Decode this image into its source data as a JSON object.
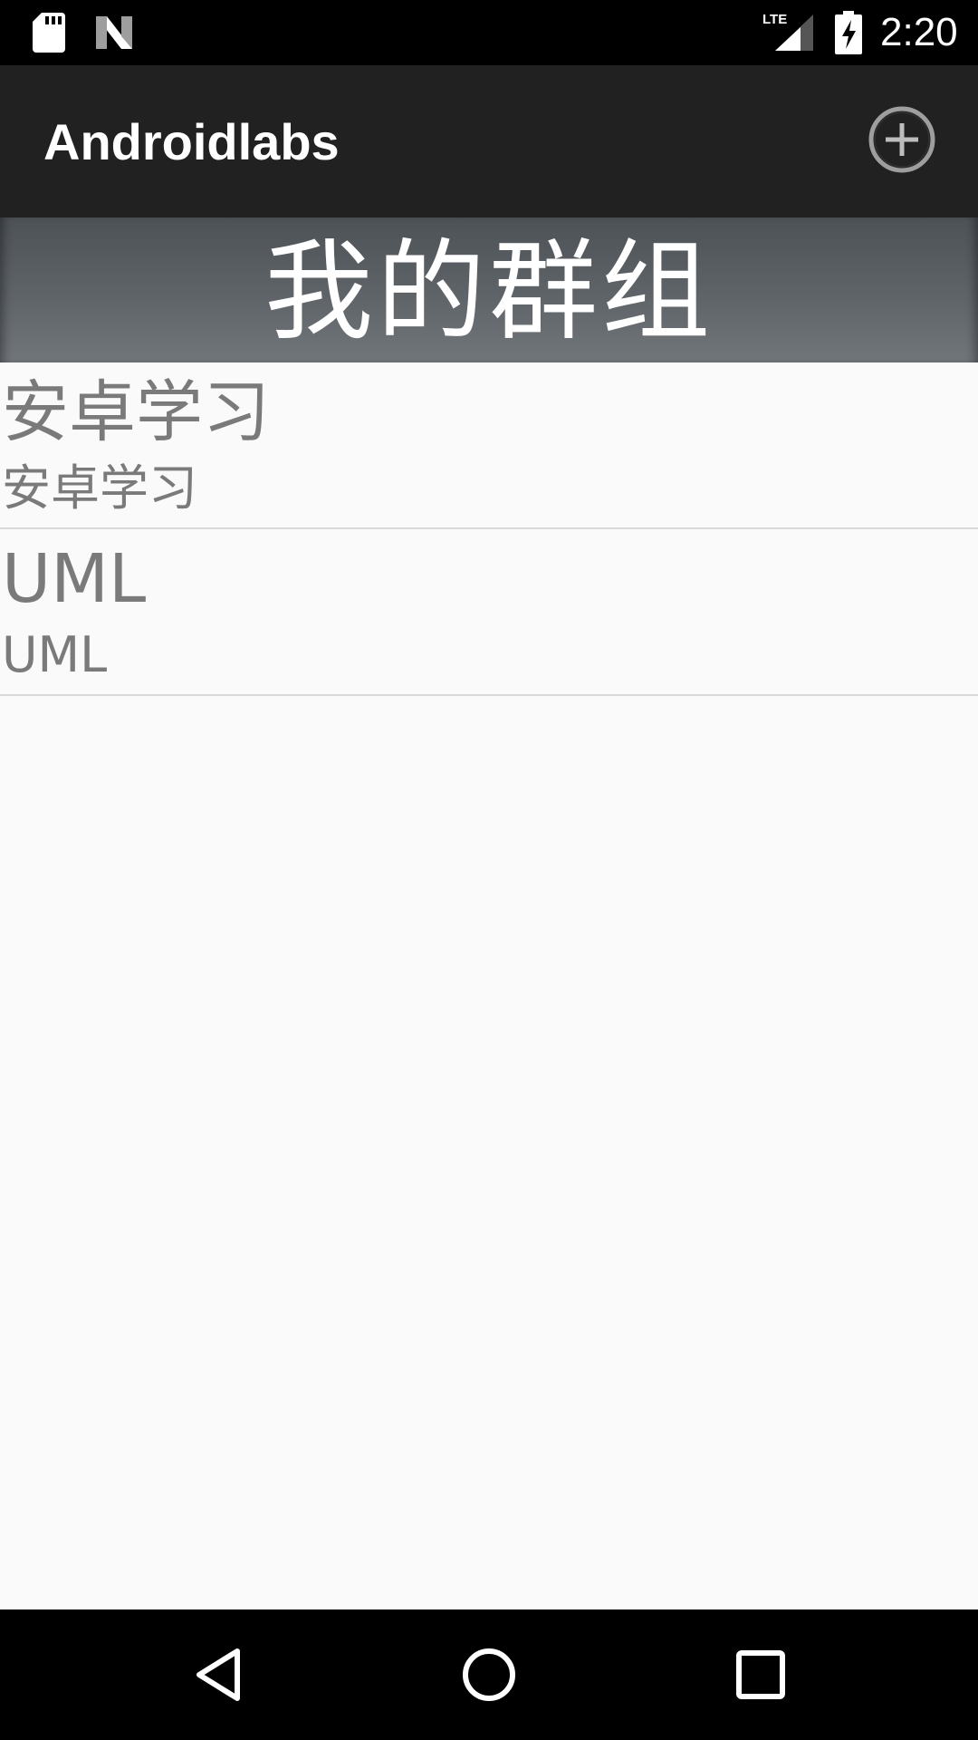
{
  "status_bar": {
    "time": "2:20",
    "icons": [
      "sd-card-icon",
      "n-logo-icon",
      "lte-signal-icon",
      "battery-charging-icon"
    ]
  },
  "app_bar": {
    "title": "Androidlabs",
    "action_icon": "add-circle-icon"
  },
  "group_header": {
    "title": "我的群组"
  },
  "groups": [
    {
      "title": "安卓学习",
      "subtitle": "安卓学习"
    },
    {
      "title": "UML",
      "subtitle": "UML"
    }
  ],
  "nav_bar": {
    "icons": [
      "back-icon",
      "home-icon",
      "recents-icon"
    ]
  },
  "colors": {
    "status_bar": "#000000",
    "app_bar": "#212121",
    "header_gradient_top": "#4d5257",
    "header_gradient_bottom": "#71767b",
    "content_bg": "#fafafa",
    "item_text": "#7a7a7a",
    "divider": "#d9d9d9"
  }
}
